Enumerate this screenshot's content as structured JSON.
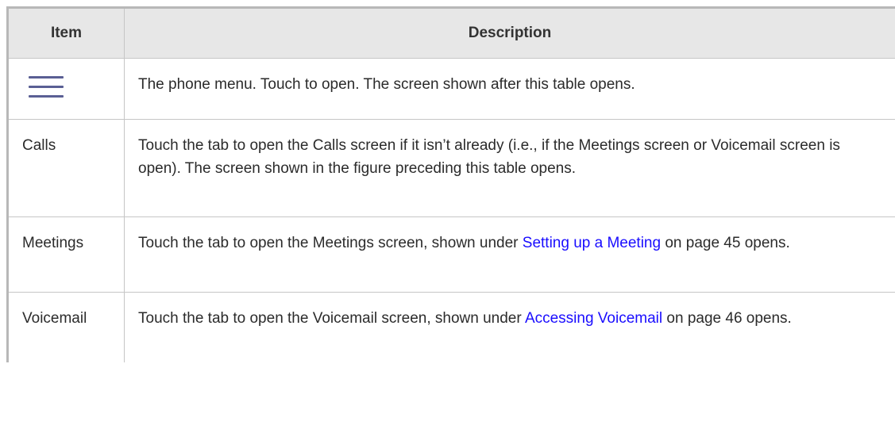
{
  "table": {
    "headers": {
      "item": "Item",
      "description": "Description"
    },
    "rows": [
      {
        "item_icon": "hamburger-menu-icon",
        "description": "The phone menu. Touch to open. The screen shown after this table opens."
      },
      {
        "item": "Calls",
        "description": "Touch the tab to open the Calls screen if it isn’t already (i.e., if the Meetings screen or Voicemail screen is open). The screen shown in the figure preceding this table opens."
      },
      {
        "item": "Meetings",
        "description_before_link": "Touch the tab to open the Meetings screen, shown under ",
        "link": "Setting up a Meeting",
        "description_after_link": " on page 45 opens."
      },
      {
        "item": "Voicemail",
        "description_before_link": "Touch the tab to open the Voicemail screen, shown under ",
        "link": "Accessing Voicemail",
        "description_after_link": " on page 46 opens."
      }
    ]
  },
  "colors": {
    "link": "#1a0dff",
    "header_background": "#e7e7e7",
    "menu_icon": "#5a5f94"
  }
}
